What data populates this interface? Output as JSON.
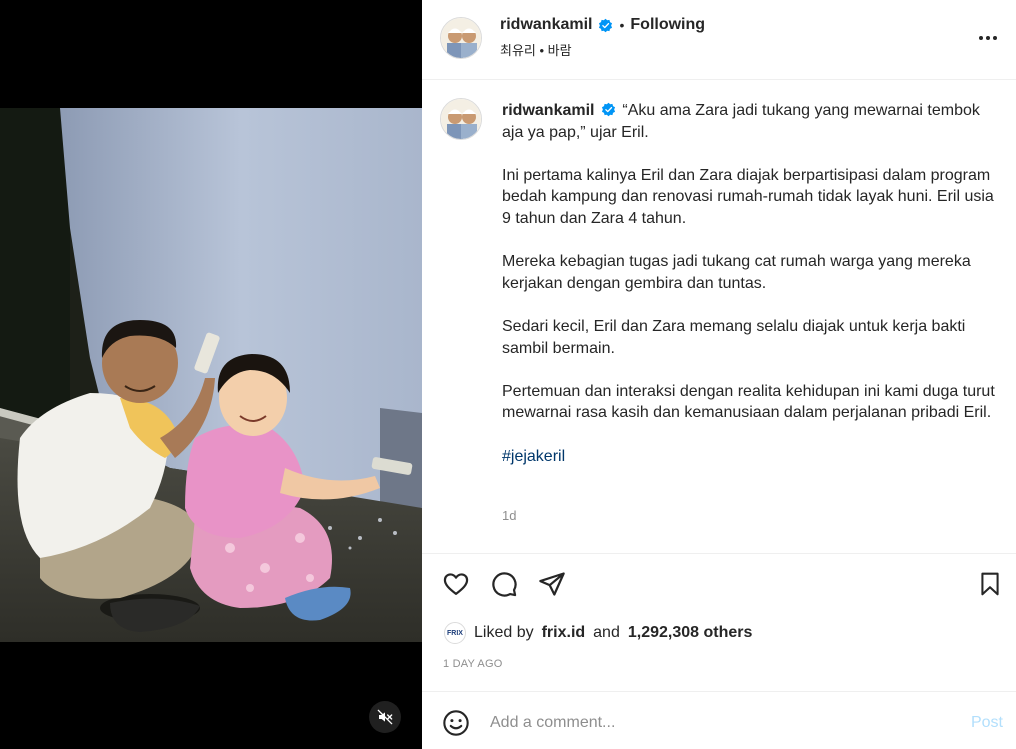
{
  "post": {
    "author": "ridwankamil",
    "verified": true,
    "follow_separator": "•",
    "follow_status": "Following",
    "subline": "최유리 • 바람",
    "caption_quote": "“Aku ama Zara jadi tukang yang mewarnai tembok aja ya pap,” ujar Eril.",
    "caption_paragraphs": [
      "Ini pertama kalinya Eril dan Zara diajak berpartisipasi dalam program bedah kampung dan renovasi rumah-rumah tidak layak huni. Eril usia 9 tahun dan Zara 4 tahun.",
      "Mereka kebagian tugas jadi tukang cat rumah warga yang mereka kerjakan dengan gembira dan tuntas.",
      "Sedari kecil, Eril dan Zara memang selalu diajak untuk kerja bakti sambil bermain.",
      "Pertemuan dan interaksi dengan realita kehidupan ini kami duga turut mewarnai rasa kasih dan kemanusiaan dalam perjalanan pribadi Eril."
    ],
    "hashtag": "#jejakeril",
    "caption_age": "1d",
    "liked_by_prefix": "Liked by",
    "liked_by_user": "frix.id",
    "liked_by_and": "and",
    "liked_by_others": "1,292,308 others",
    "liker_avatar_text": "FRIX",
    "posted_time": "1 DAY AGO"
  },
  "comment": {
    "placeholder": "Add a comment...",
    "post_label": "Post"
  },
  "icons": {
    "more": "more-options-icon",
    "like": "heart-icon",
    "comment": "comment-icon",
    "share": "share-icon",
    "save": "bookmark-icon",
    "emoji": "emoji-icon",
    "mute": "audio-muted-icon",
    "verified": "verified-badge-icon"
  },
  "colors": {
    "verified_blue": "#0095f6",
    "link_blue": "#00376b",
    "post_disabled": "#b2dffc",
    "muted_text": "#8e8e8e"
  }
}
